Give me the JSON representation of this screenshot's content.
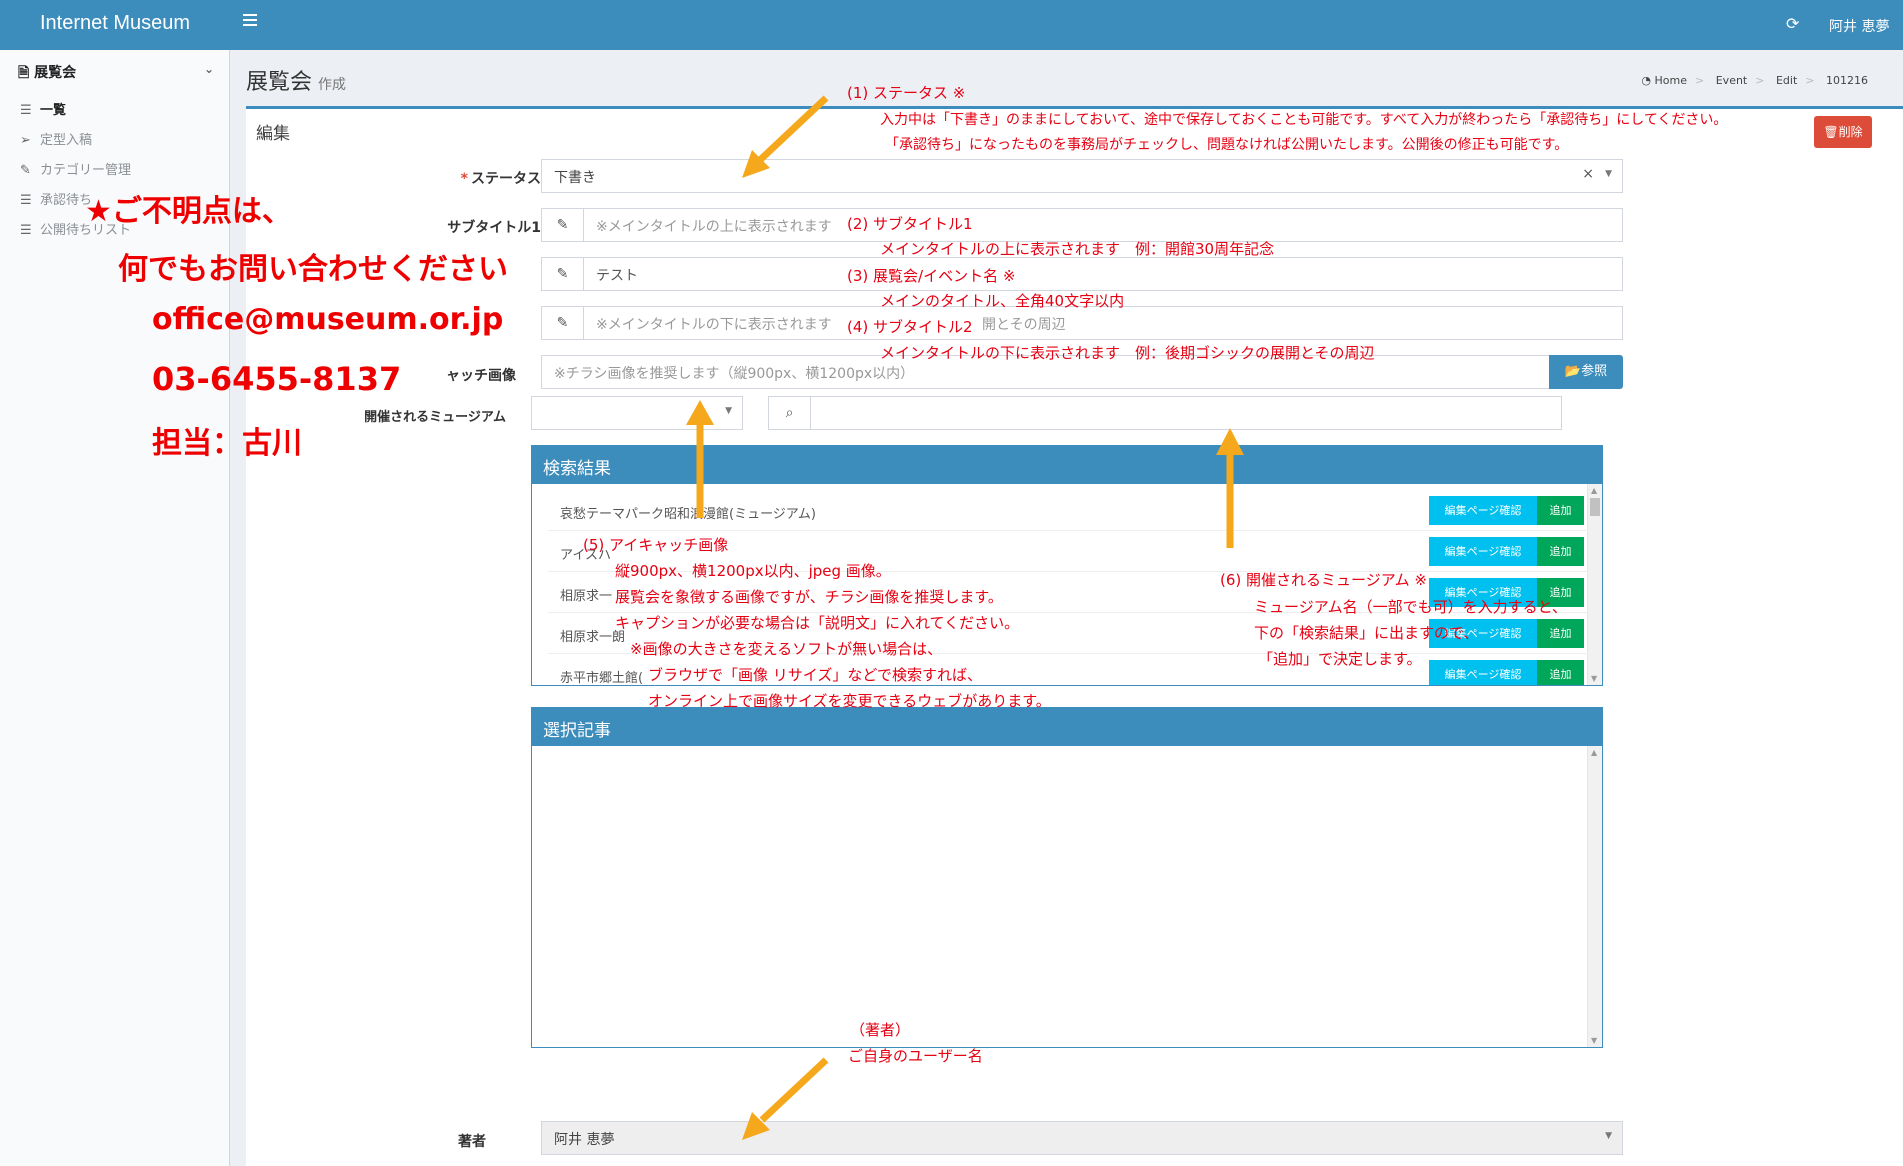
{
  "topbar": {
    "brand": "Internet Museum",
    "user": "阿井 恵夢"
  },
  "sidebar": {
    "header": "展覧会",
    "items": [
      {
        "label": "一覧",
        "icon": "list-icon"
      },
      {
        "label": "定型入稿",
        "icon": "paper-plane-icon"
      },
      {
        "label": "カテゴリー管理",
        "icon": "pencil-icon"
      },
      {
        "label": "承認待ち",
        "icon": "list-icon"
      },
      {
        "label": "公開待ちリスト",
        "icon": "list-icon"
      }
    ]
  },
  "page": {
    "title": "展覧会",
    "subtitle": "作成"
  },
  "breadcrumb": [
    "Home",
    "Event",
    "Edit",
    "101216"
  ],
  "box": {
    "title": "編集",
    "delete_label": "削除"
  },
  "form": {
    "status_label": "ステータス",
    "status_value": "下書き",
    "subtitle1_label": "サブタイトル1",
    "subtitle1_placeholder": "※メインタイトルの上に表示されます",
    "title_value": "テスト",
    "subtitle2_placeholder": "※メインタイトルの下に表示されます",
    "subtitle2_hint": "開とその周辺",
    "eyecatch_label": "ャッチ画像",
    "eyecatch_placeholder": "※チラシ画像を推奨します（縦900px、横1200px以内）",
    "browse_label": "参照",
    "museum_label": "開催されるミュージアム",
    "author_label": "著者",
    "author_value": "阿井 恵夢"
  },
  "results": {
    "title": "検索結果",
    "edit_label": "編集ページ確認",
    "add_label": "追加",
    "rows": [
      "哀愁テーマパーク昭和浪漫館(ミュージアム)",
      "アイスハ",
      "相原求一",
      "相原求一朗",
      "赤平市郷土館("
    ]
  },
  "selected": {
    "title": "選択記事"
  },
  "annotations": {
    "a1": [
      "(1) ステータス ※",
      "入力中は「下書き」のままにしておいて、途中で保存しておくことも可能です。すべて入力が終わったら「承認待ち」にしてください。",
      "「承認待ち」になったものを事務局がチェックし、問題なければ公開いたします。公開後の修正も可能です。"
    ],
    "a2": [
      "(2) サブタイトル1",
      "メインタイトルの上に表示されます　例：開館30周年記念"
    ],
    "a3": [
      "(3) 展覧会/イベント名 ※",
      "メインのタイトル、全角40文字以内"
    ],
    "a4": [
      "(4) サブタイトル2",
      "メインタイトルの下に表示されます　例：後期ゴシックの展開とその周辺"
    ],
    "a5": [
      "(5) アイキャッチ画像",
      "縦900px、横1200px以内、jpeg 画像。",
      "展覧会を象徴する画像ですが、チラシ画像を推奨します。",
      "キャプションが必要な場合は「説明文」に入れてください。",
      "※画像の大きさを変えるソフトが無い場合は、",
      "ブラウザで「画像 リサイズ」などで検索すれば、",
      "オンライン上で画像サイズを変更できるウェブがあります。"
    ],
    "a6": [
      "(6) 開催されるミュージアム ※",
      "ミュージアム名（一部でも可）を入力すると、",
      "下の「検索結果」に出ますので、",
      "「追加」で決定します。"
    ],
    "a7": [
      "（著者）",
      "ご自身のユーザー名"
    ],
    "contact": [
      "★ご不明点は、",
      "何でもお問い合わせください",
      "office@museum.or.jp",
      "03-6455-8137",
      "担当：古川"
    ]
  }
}
